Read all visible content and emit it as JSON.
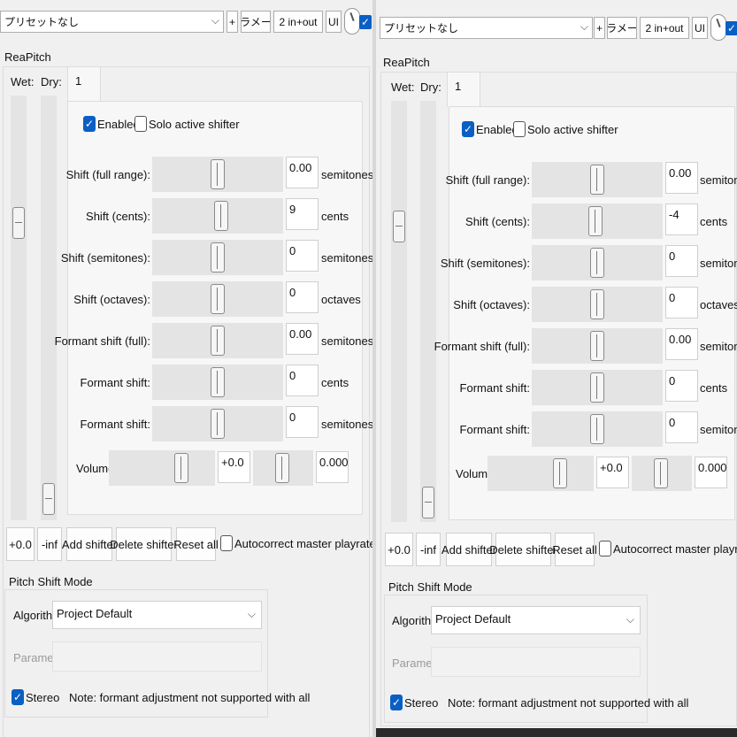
{
  "left": {
    "toolbar": {
      "preset": "プリセットなし",
      "plus": "+",
      "params": "パラメータ",
      "io": "2 in+out",
      "ui": "UI"
    },
    "plugin_name": "ReaPitch",
    "wet_label": "Wet:",
    "dry_label": "Dry:",
    "tab_label": "1",
    "enabled_label": "Enabled",
    "solo_label": "Solo active shifter",
    "rows": [
      {
        "label": "Shift (full range):",
        "value": "0.00",
        "unit": "semitones"
      },
      {
        "label": "Shift (cents):",
        "value": "9",
        "unit": "cents"
      },
      {
        "label": "Shift (semitones):",
        "value": "0",
        "unit": "semitones"
      },
      {
        "label": "Shift (octaves):",
        "value": "0",
        "unit": "octaves"
      },
      {
        "label": "Formant shift (full):",
        "value": "0.00",
        "unit": "semitones"
      },
      {
        "label": "Formant shift:",
        "value": "0",
        "unit": "cents"
      },
      {
        "label": "Formant shift:",
        "value": "0",
        "unit": "semitones"
      }
    ],
    "volume_label": "Volume:",
    "volume_value": "+0.0",
    "pan_value": "0.000",
    "wet_value": "+0.0",
    "dry_value": "-inf",
    "add_shifter": "Add shifter",
    "delete_shifter": "Delete shifter",
    "reset_all": "Reset all",
    "autocorrect": "Autocorrect master playrate changes",
    "mode_title": "Pitch Shift Mode",
    "algorithm_label": "Algorithm:",
    "algorithm_value": "Project Default",
    "parameter_label": "Parameter:",
    "stereo_label": "Stereo",
    "note": "Note: formant adjustment not supported with all"
  },
  "right": {
    "toolbar": {
      "preset": "プリセットなし",
      "plus": "+",
      "params": "パラメータ",
      "io": "2 in+out",
      "ui": "UI"
    },
    "plugin_name": "ReaPitch",
    "wet_label": "Wet:",
    "dry_label": "Dry:",
    "tab_label": "1",
    "enabled_label": "Enabled",
    "solo_label": "Solo active shifter",
    "rows": [
      {
        "label": "Shift (full range):",
        "value": "0.00",
        "unit": "semitones"
      },
      {
        "label": "Shift (cents):",
        "value": "-4",
        "unit": "cents"
      },
      {
        "label": "Shift (semitones):",
        "value": "0",
        "unit": "semitones"
      },
      {
        "label": "Shift (octaves):",
        "value": "0",
        "unit": "octaves"
      },
      {
        "label": "Formant shift (full):",
        "value": "0.00",
        "unit": "semitones"
      },
      {
        "label": "Formant shift:",
        "value": "0",
        "unit": "cents"
      },
      {
        "label": "Formant shift:",
        "value": "0",
        "unit": "semitones"
      }
    ],
    "volume_label": "Volume:",
    "volume_value": "+0.0",
    "pan_value": "0.000",
    "wet_value": "+0.0",
    "dry_value": "-inf",
    "add_shifter": "Add shifter",
    "delete_shifter": "Delete shifter",
    "reset_all": "Reset all",
    "autocorrect": "Autocorrect master playrate changes",
    "mode_title": "Pitch Shift Mode",
    "algorithm_label": "Algorithm:",
    "algorithm_value": "Project Default",
    "parameter_label": "Parameter:",
    "stereo_label": "Stereo",
    "note": "Note: formant adjustment not supported with all"
  }
}
